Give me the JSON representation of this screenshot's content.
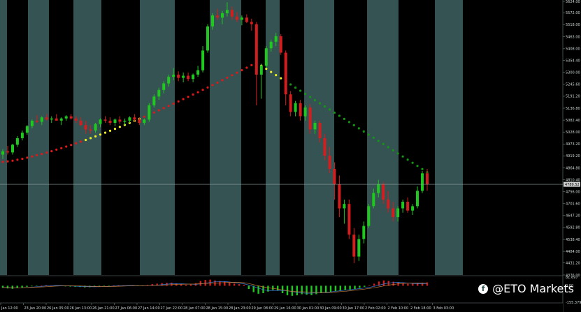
{
  "colors": {
    "zone_teal": "#355353",
    "zone_black": "#000000",
    "bull_candle": "#1ec81e",
    "bear_candle": "#d21e1e",
    "trail_red": "#e01818",
    "trail_yellow": "#f0f020",
    "trail_green": "#149614",
    "axis_text": "#cfd8d8",
    "price_tag": "#d0d0d0"
  },
  "price_axis": {
    "labels": [
      "5624.00",
      "5572.00",
      "5518.00",
      "5463.00",
      "5408.00",
      "5354.40",
      "5300.00",
      "5245.60",
      "5191.20",
      "5136.80",
      "5082.40",
      "5028.00",
      "4973.20",
      "4919.20",
      "4864.80",
      "4810.40",
      "4756.00",
      "4701.60",
      "4647.20",
      "4592.80",
      "4538.40",
      "4484.00",
      "4431.20",
      "4376.00"
    ],
    "current_price": "4789.52"
  },
  "oscillator_axis": {
    "labels": [
      "81.697",
      "0.00",
      "-155.379"
    ]
  },
  "time_axis": {
    "labels": [
      "Jan 12:00",
      "23 Jan 20:00",
      "26 Jan 05:00",
      "26 Jan 13:00",
      "26 Jan 21:00",
      "27 Jan 06:00",
      "27 Jan 14:00",
      "27 Jan 22:00",
      "28 Jan 07:00",
      "28 Jan 15:00",
      "28 Jan 23:00",
      "29 Jan 08:00",
      "29 Jan 16:00",
      "30 Jan 01:00",
      "30 Jan 09:00",
      "30 Jan 17:00",
      "2 Feb 02:00",
      "2 Feb 10:00",
      "2 Feb 18:00",
      "3 Feb 03:00"
    ]
  },
  "watermark": {
    "icon": "facebook-icon",
    "text": "@ETO Markets"
  },
  "chart_data": {
    "type": "candlestick",
    "ylim": [
      4376.0,
      5624.0
    ],
    "current_price": 4789.52,
    "candles": [
      [
        4925,
        4950,
        4905,
        4940
      ],
      [
        4940,
        4965,
        4925,
        4935
      ],
      [
        4935,
        4975,
        4925,
        4970
      ],
      [
        4970,
        5010,
        4960,
        5000
      ],
      [
        5000,
        5035,
        4990,
        5025
      ],
      [
        5025,
        5060,
        5015,
        5055
      ],
      [
        5055,
        5085,
        5045,
        5080
      ],
      [
        5080,
        5105,
        5070,
        5075
      ],
      [
        5075,
        5100,
        5060,
        5095
      ],
      [
        5095,
        5110,
        5080,
        5085
      ],
      [
        5085,
        5100,
        5070,
        5090
      ],
      [
        5090,
        5110,
        5080,
        5080
      ],
      [
        5080,
        5095,
        5060,
        5090
      ],
      [
        5090,
        5105,
        5080,
        5100
      ],
      [
        5100,
        5110,
        5085,
        5090
      ],
      [
        5090,
        5100,
        5070,
        5080
      ],
      [
        5080,
        5095,
        5055,
        5060
      ],
      [
        5060,
        5080,
        5020,
        5040
      ],
      [
        5040,
        5060,
        5020,
        5035
      ],
      [
        5035,
        5070,
        5025,
        5065
      ],
      [
        5065,
        5090,
        5050,
        5085
      ],
      [
        5085,
        5100,
        5070,
        5080
      ],
      [
        5080,
        5095,
        5060,
        5070
      ],
      [
        5070,
        5090,
        5055,
        5085
      ],
      [
        5085,
        5100,
        5065,
        5075
      ],
      [
        5075,
        5090,
        5060,
        5080
      ],
      [
        5080,
        5100,
        5070,
        5095
      ],
      [
        5095,
        5110,
        5075,
        5085
      ],
      [
        5085,
        5095,
        5060,
        5070
      ],
      [
        5070,
        5090,
        5060,
        5085
      ],
      [
        5085,
        5160,
        5075,
        5150
      ],
      [
        5150,
        5200,
        5140,
        5190
      ],
      [
        5190,
        5230,
        5175,
        5220
      ],
      [
        5220,
        5260,
        5205,
        5250
      ],
      [
        5250,
        5290,
        5235,
        5280
      ],
      [
        5280,
        5320,
        5265,
        5290
      ],
      [
        5290,
        5305,
        5260,
        5275
      ],
      [
        5275,
        5300,
        5255,
        5285
      ],
      [
        5285,
        5300,
        5260,
        5270
      ],
      [
        5270,
        5295,
        5255,
        5290
      ],
      [
        5290,
        5330,
        5280,
        5310
      ],
      [
        5310,
        5420,
        5300,
        5400
      ],
      [
        5400,
        5520,
        5390,
        5510
      ],
      [
        5510,
        5570,
        5495,
        5560
      ],
      [
        5560,
        5590,
        5540,
        5550
      ],
      [
        5550,
        5580,
        5520,
        5570
      ],
      [
        5570,
        5620,
        5555,
        5585
      ],
      [
        5585,
        5600,
        5540,
        5555
      ],
      [
        5555,
        5575,
        5530,
        5540
      ],
      [
        5540,
        5560,
        5515,
        5550
      ],
      [
        5550,
        5565,
        5525,
        5530
      ],
      [
        5530,
        5545,
        5490,
        5520
      ],
      [
        5520,
        5530,
        5150,
        5290
      ],
      [
        5290,
        5340,
        5180,
        5330
      ],
      [
        5330,
        5420,
        5320,
        5410
      ],
      [
        5410,
        5450,
        5395,
        5440
      ],
      [
        5440,
        5480,
        5420,
        5465
      ],
      [
        5465,
        5475,
        5380,
        5390
      ],
      [
        5390,
        5400,
        5150,
        5200
      ],
      [
        5200,
        5215,
        5100,
        5120
      ],
      [
        5120,
        5170,
        5100,
        5160
      ],
      [
        5160,
        5175,
        5080,
        5100
      ],
      [
        5100,
        5150,
        5080,
        5140
      ],
      [
        5140,
        5155,
        5020,
        5040
      ],
      [
        5040,
        5080,
        5020,
        5070
      ],
      [
        5070,
        5080,
        4980,
        5000
      ],
      [
        5000,
        5020,
        4900,
        4920
      ],
      [
        4920,
        4960,
        4840,
        4860
      ],
      [
        4860,
        4890,
        4720,
        4790
      ],
      [
        4790,
        4830,
        4640,
        4680
      ],
      [
        4680,
        4720,
        4610,
        4700
      ],
      [
        4700,
        4720,
        4540,
        4560
      ],
      [
        4560,
        4590,
        4430,
        4460
      ],
      [
        4460,
        4560,
        4440,
        4540
      ],
      [
        4540,
        4620,
        4520,
        4600
      ],
      [
        4600,
        4700,
        4590,
        4690
      ],
      [
        4690,
        4770,
        4680,
        4750
      ],
      [
        4750,
        4810,
        4730,
        4790
      ],
      [
        4790,
        4800,
        4700,
        4720
      ],
      [
        4720,
        4760,
        4660,
        4680
      ],
      [
        4680,
        4710,
        4620,
        4640
      ],
      [
        4640,
        4690,
        4620,
        4680
      ],
      [
        4680,
        4720,
        4660,
        4710
      ],
      [
        4710,
        4730,
        4660,
        4670
      ],
      [
        4670,
        4700,
        4650,
        4690
      ],
      [
        4690,
        4780,
        4680,
        4760
      ],
      [
        4760,
        4850,
        4750,
        4840
      ],
      [
        4840,
        4860,
        4760,
        4790
      ]
    ],
    "trailing_stop": {
      "start": 4892,
      "end": 4845,
      "peak_index": 52,
      "peak_value": 5345,
      "yellow_segments": [
        [
          17,
          28
        ],
        [
          52,
          58
        ]
      ],
      "green_from_index": 58
    },
    "oscillator": {
      "ylim": [
        -155.379,
        81.697
      ],
      "histogram": [
        -20,
        -25,
        -28,
        -22,
        -18,
        -10,
        -5,
        -2,
        4,
        6,
        5,
        2,
        -3,
        -6,
        -8,
        -10,
        -12,
        -15,
        -14,
        -10,
        -6,
        -4,
        -2,
        3,
        5,
        4,
        2,
        1,
        -2,
        -4,
        8,
        15,
        20,
        25,
        28,
        30,
        22,
        15,
        10,
        12,
        25,
        45,
        55,
        58,
        50,
        45,
        40,
        30,
        20,
        15,
        10,
        -30,
        -60,
        -75,
        -70,
        -55,
        -40,
        -45,
        -70,
        -90,
        -95,
        -90,
        -80,
        -85,
        -88,
        -80,
        -70,
        -65,
        -60,
        -50,
        -45,
        -40,
        -35,
        -30,
        -20,
        -10,
        5,
        20,
        40,
        50,
        45,
        38,
        30,
        25,
        20,
        22,
        25,
        30,
        32
      ]
    }
  }
}
